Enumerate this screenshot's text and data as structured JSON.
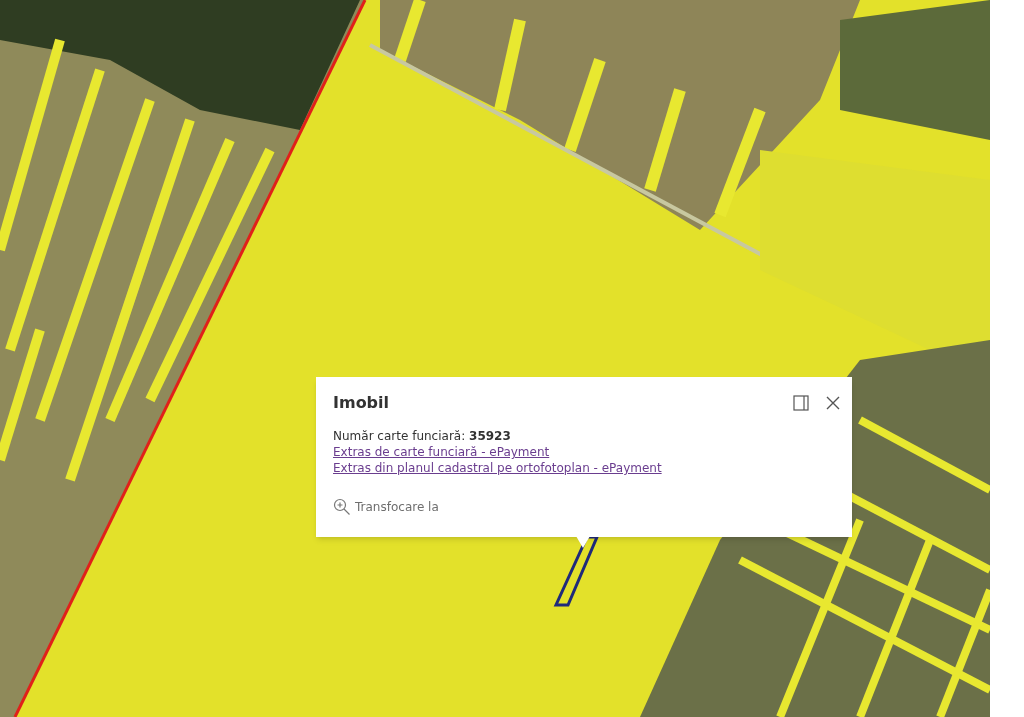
{
  "popup": {
    "title": "Imobil",
    "attribute": "Număr carte funciară: **35923**",
    "links": [
      "Extras de carte funciară - ePayment",
      "Extras din planul cadastral pe ortofotoplan - ePayment"
    ],
    "action": {
      "label": "Transfocare la"
    }
  }
}
